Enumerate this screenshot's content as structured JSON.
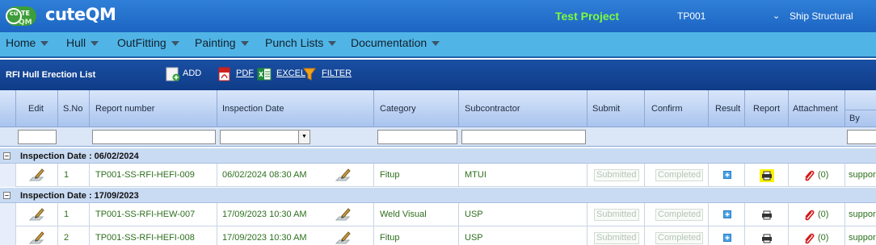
{
  "app": {
    "logo_text": "cuTE QM",
    "brand": "cuteQM",
    "project_name": "Test Project",
    "project_code": "TP001",
    "project_type": "Ship Structural"
  },
  "menu": [
    "Home",
    "Hull",
    "OutFitting",
    "Painting",
    "Punch Lists",
    "Documentation"
  ],
  "toolbar": {
    "title": "RFI Hull Erection List",
    "add": "ADD",
    "pdf": "PDF",
    "excel": "EXCEL",
    "filter": "FILTER"
  },
  "columns": [
    "Edit",
    "S.No",
    "Report number",
    "Inspection Date",
    "Category",
    "Subcontractor",
    "Submit",
    "Confirm",
    "Result",
    "Report",
    "Attachment",
    "By"
  ],
  "groups": [
    {
      "label": "Inspection Date : 06/02/2024",
      "rows": [
        {
          "sno": "1",
          "report_number": "TP001-SS-RFI-HEFI-009",
          "inspection_date": "06/02/2024 08:30 AM",
          "category": "Fitup",
          "subcontractor": "MTUI",
          "submit": "Submitted",
          "confirm": "Completed",
          "attachment": "(0)",
          "by": "suppor"
        }
      ]
    },
    {
      "label": "Inspection Date : 17/09/2023",
      "rows": [
        {
          "sno": "1",
          "report_number": "TP001-SS-RFI-HEW-007",
          "inspection_date": "17/09/2023 10:30 AM",
          "category": "Weld Visual",
          "subcontractor": "USP",
          "submit": "Submitted",
          "confirm": "Completed",
          "attachment": "(0)",
          "by": "suppor"
        },
        {
          "sno": "2",
          "report_number": "TP001-SS-RFI-HEFI-008",
          "inspection_date": "17/09/2023 10:30 AM",
          "category": "Fitup",
          "subcontractor": "USP",
          "submit": "Submitted",
          "confirm": "Completed",
          "attachment": "(0)",
          "by": "suppor"
        }
      ]
    }
  ]
}
